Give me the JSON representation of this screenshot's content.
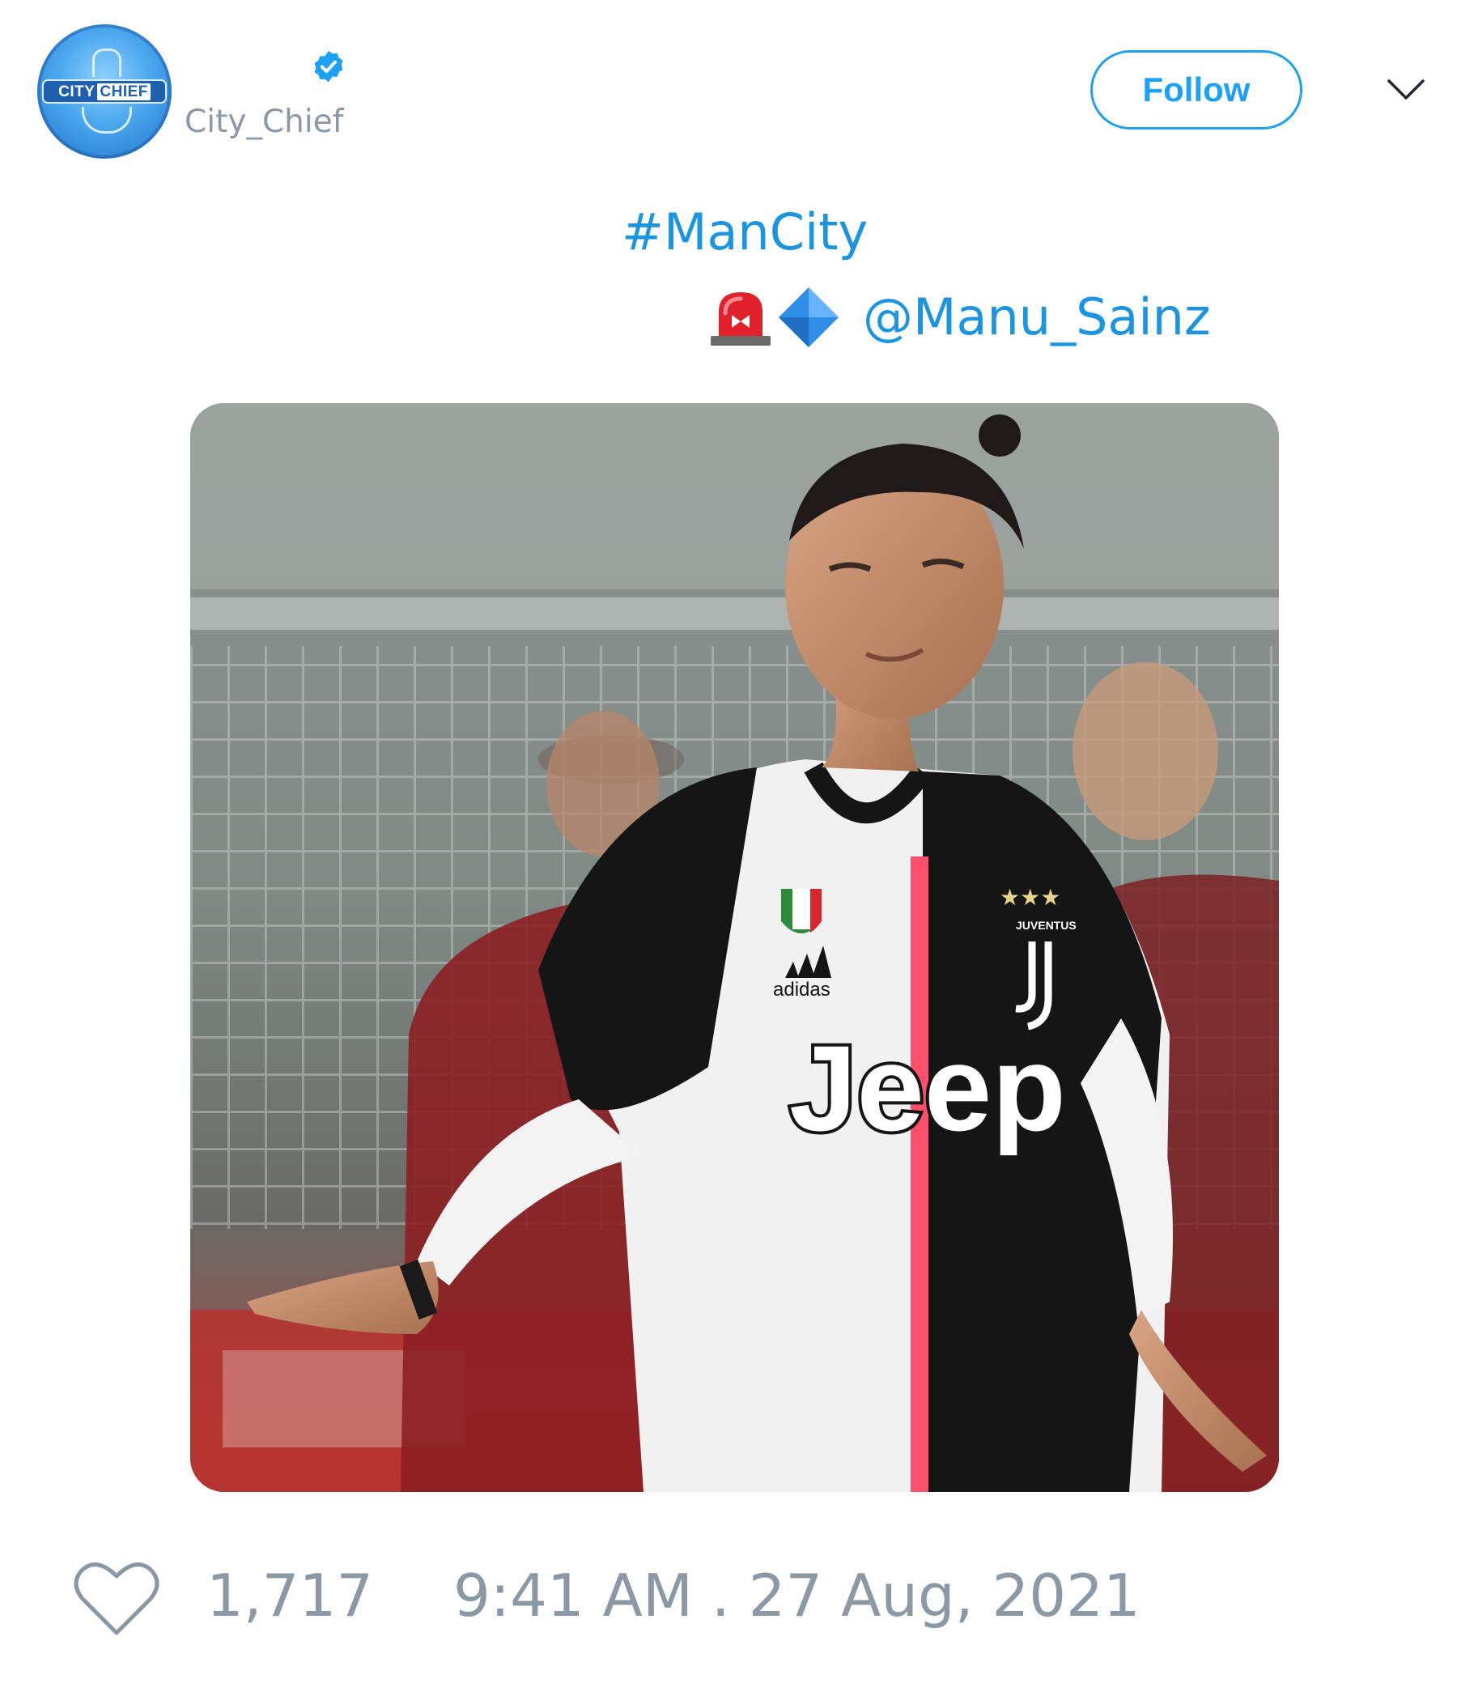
{
  "tweet": {
    "avatar": {
      "alt_word_1": "CITY",
      "alt_word_2": "CHIEF"
    },
    "handle": "City_Chief",
    "verified": true,
    "follow_label": "Follow",
    "hashtag": "#ManCity",
    "mention": "@Manu_Sainz",
    "emojis": [
      "siren-icon",
      "blue-diamond-icon"
    ],
    "media": {
      "kit_sponsor": "Jeep",
      "kit_maker": "adidas",
      "club_mark": "JUVENTUS"
    },
    "likes": "1,717",
    "timestamp": "9:41 AM . 27 Aug, 2021"
  },
  "colors": {
    "accent": "#1da1f2",
    "link": "#1b95e0",
    "muted": "#8b98a5",
    "verified": "#1da1f2"
  }
}
